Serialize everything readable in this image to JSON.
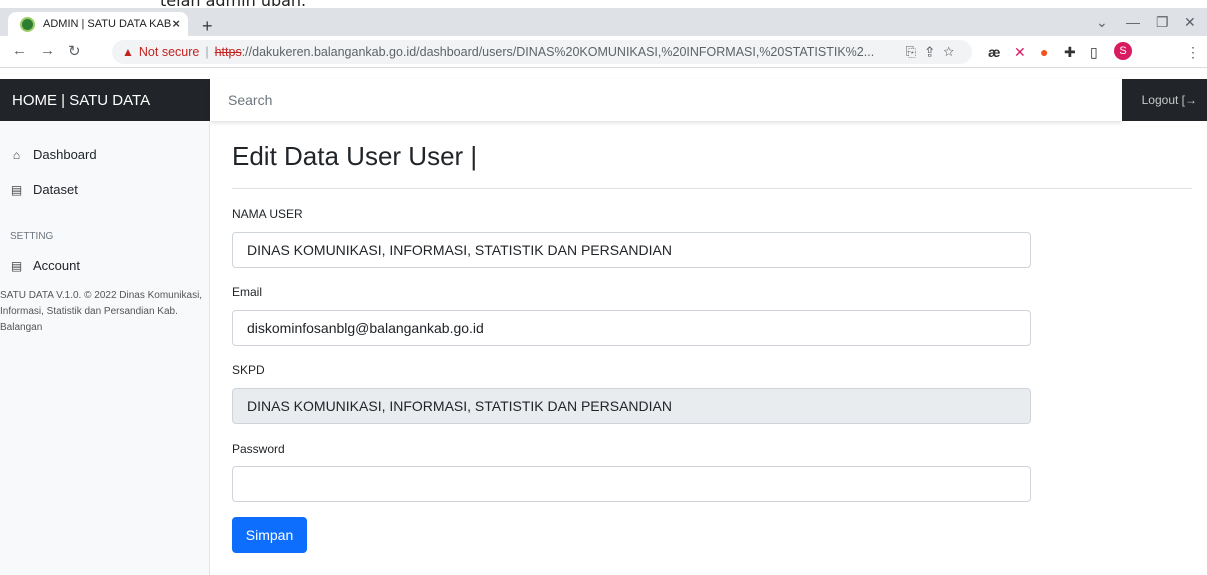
{
  "browser": {
    "tab_title": "ADMIN | SATU DATA KAB BALAN",
    "url_security": "Not secure",
    "url_scheme": "https",
    "url_rest": "://dakukeren.balangankab.go.id/dashboard/users/DINAS%20KOMUNIKASI,%20INFORMASI,%20STATISTIK%2...",
    "profile_initial": "S"
  },
  "doc_text_fragment": "telah admin ubah.",
  "header": {
    "brand": "HOME | SATU DATA",
    "search_placeholder": "Search",
    "logout_label": "Logout [→"
  },
  "sidebar": {
    "items": [
      {
        "label": "Dashboard",
        "icon": "home-icon"
      },
      {
        "label": "Dataset",
        "icon": "file-icon"
      }
    ],
    "section_heading": "SETTING",
    "account_label": "Account",
    "footer": "SATU DATA V.1.0. © 2022 Dinas Komunikasi, Informasi, Statistik dan Persandian Kab. Balangan"
  },
  "form": {
    "title": "Edit Data User User |",
    "fields": [
      {
        "label": "NAMA USER",
        "value": "DINAS KOMUNIKASI, INFORMASI, STATISTIK DAN PERSANDIAN"
      },
      {
        "label": "Email",
        "value": "diskominfosanblg@balangankab.go.id"
      },
      {
        "label": "SKPD",
        "value": "DINAS KOMUNIKASI, INFORMASI, STATISTIK DAN PERSANDIAN"
      },
      {
        "label": "Password",
        "value": ""
      }
    ],
    "submit_label": "Simpan"
  },
  "colors": {
    "primary": "#0d6efd",
    "dark": "#212529",
    "warning_red": "#c5221f"
  }
}
